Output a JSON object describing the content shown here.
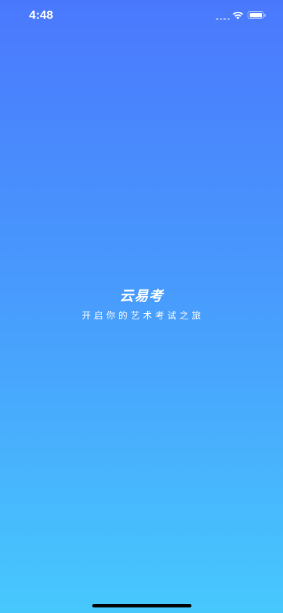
{
  "status_bar": {
    "time": "4:48",
    "signal_icon": "cellular-signal-icon",
    "wifi_icon": "wifi-icon",
    "battery_icon": "battery-icon"
  },
  "splash": {
    "app_name": "云易考",
    "tagline": "开启你的艺术考试之旅"
  },
  "colors": {
    "gradient_top": "#4a78fd",
    "gradient_bottom": "#47c8fd",
    "text": "#ffffff"
  }
}
